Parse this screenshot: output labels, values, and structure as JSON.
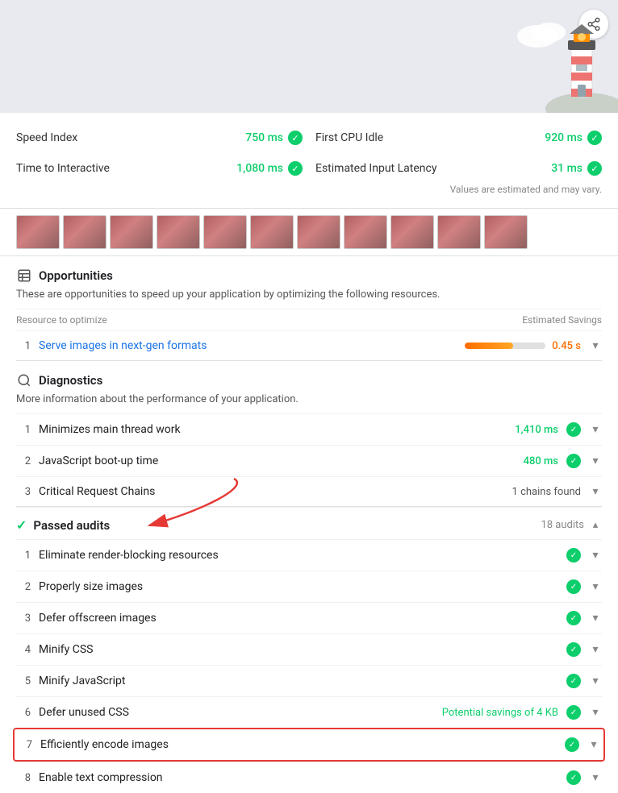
{
  "header": {
    "share_label": "Share"
  },
  "metrics": {
    "estimated_note": "Values are estimated and may vary.",
    "items": [
      {
        "label": "Speed Index",
        "value": "750 ms",
        "status": "pass"
      },
      {
        "label": "First CPU Idle",
        "value": "920 ms",
        "status": "pass"
      },
      {
        "label": "Time to Interactive",
        "value": "1,080 ms",
        "status": "pass"
      },
      {
        "label": "Estimated Input Latency",
        "value": "31 ms",
        "status": "pass"
      }
    ]
  },
  "opportunities": {
    "title": "Opportunities",
    "description": "These are opportunities to speed up your application by optimizing the following resources.",
    "table_header_resource": "Resource to optimize",
    "table_header_savings": "Estimated Savings",
    "items": [
      {
        "num": "1",
        "label": "Serve images in next-gen formats",
        "savings": "0.45 s",
        "bar_pct": 60
      }
    ]
  },
  "diagnostics": {
    "title": "Diagnostics",
    "description": "More information about the performance of your application.",
    "items": [
      {
        "num": "1",
        "label": "Minimizes main thread work",
        "value": "1,410 ms",
        "type": "green"
      },
      {
        "num": "2",
        "label": "JavaScript boot-up time",
        "value": "480 ms",
        "type": "green"
      },
      {
        "num": "3",
        "label": "Critical Request Chains",
        "value": "1 chains found",
        "type": "neutral"
      }
    ]
  },
  "passed_audits": {
    "title": "Passed audits",
    "count": "18 audits",
    "items": [
      {
        "num": "1",
        "label": "Eliminate render-blocking resources",
        "type": "check"
      },
      {
        "num": "2",
        "label": "Properly size images",
        "type": "check"
      },
      {
        "num": "3",
        "label": "Defer offscreen images",
        "type": "check"
      },
      {
        "num": "4",
        "label": "Minify CSS",
        "type": "check"
      },
      {
        "num": "5",
        "label": "Minify JavaScript",
        "type": "check"
      },
      {
        "num": "6",
        "label": "Defer unused CSS",
        "value": "Potential savings of 4 KB",
        "type": "check"
      },
      {
        "num": "7",
        "label": "Efficiently encode images",
        "type": "check",
        "highlighted": true
      },
      {
        "num": "8",
        "label": "Enable text compression",
        "type": "check"
      }
    ]
  }
}
